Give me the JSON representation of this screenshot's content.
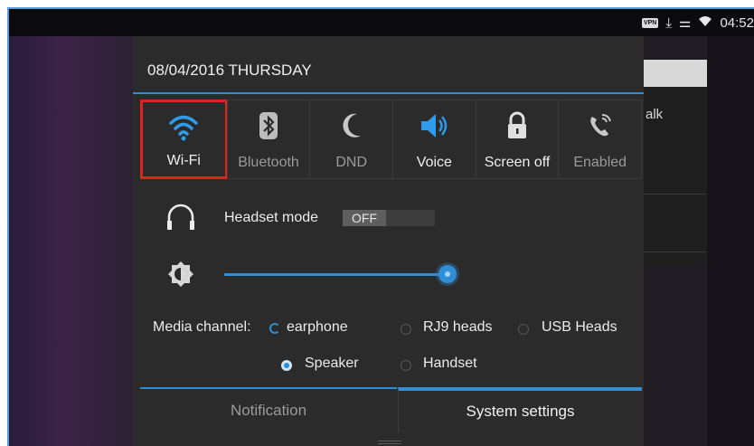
{
  "status_bar": {
    "vpn_badge": "VPN",
    "download_icon": "download-icon",
    "ethernet_icon": "ethernet-icon",
    "wifi_icon": "wifi-icon",
    "time": "04:52"
  },
  "background_app": {
    "partial_text": "alk"
  },
  "shade": {
    "date": "08/04/2016 THURSDAY",
    "tiles": [
      {
        "label": "Wi-Fi",
        "icon": "wifi-icon",
        "highlighted": true
      },
      {
        "label": "Bluetooth",
        "icon": "bluetooth-icon"
      },
      {
        "label": "DND",
        "icon": "moon-icon"
      },
      {
        "label": "Voice",
        "icon": "speaker-icon"
      },
      {
        "label": "Screen off",
        "icon": "lock-icon"
      },
      {
        "label": "Enabled",
        "icon": "call-forward-icon"
      }
    ],
    "headset": {
      "label": "Headset mode",
      "toggle": "OFF"
    },
    "brightness": {
      "level": 0.99
    },
    "media_channel": {
      "label": "Media channel:",
      "options": [
        {
          "label": "Earphone",
          "shown": "earphone",
          "selected": false
        },
        {
          "label": "RJ9 heads",
          "selected": false
        },
        {
          "label": "USB Heads",
          "selected": false
        },
        {
          "label": "Speaker",
          "selected": true
        },
        {
          "label": "Handset",
          "selected": false
        }
      ]
    },
    "tabs": {
      "notification": "Notification",
      "system_settings": "System settings"
    }
  },
  "colors": {
    "accent": "#2f8fd6",
    "highlight_border": "#e0231f",
    "shade_bg": "#2b2b2b"
  }
}
